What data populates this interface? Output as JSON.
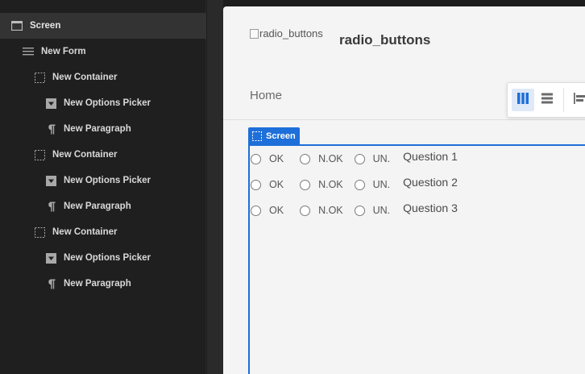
{
  "tree": [
    {
      "label": "Screen",
      "icon": "screen-icon",
      "selected": true
    },
    {
      "label": "New Form",
      "icon": "form-icon"
    },
    {
      "label": "New Container",
      "icon": "container-icon"
    },
    {
      "label": "New Options Picker",
      "icon": "dropdown-icon"
    },
    {
      "label": "New Paragraph",
      "icon": "paragraph-icon"
    },
    {
      "label": "New Container",
      "icon": "container-icon"
    },
    {
      "label": "New Options Picker",
      "icon": "dropdown-icon"
    },
    {
      "label": "New Paragraph",
      "icon": "paragraph-icon"
    },
    {
      "label": "New Container",
      "icon": "container-icon"
    },
    {
      "label": "New Options Picker",
      "icon": "dropdown-icon"
    },
    {
      "label": "New Paragraph",
      "icon": "paragraph-icon"
    }
  ],
  "app": {
    "icon_alt": "radio_buttons",
    "title": "radio_buttons"
  },
  "nav": {
    "home": "Home"
  },
  "toolbar": {
    "buttons": [
      "columns-icon",
      "rows-icon",
      "align-left-icon"
    ],
    "active": "columns-icon"
  },
  "selection": {
    "tag": "Screen"
  },
  "questions": [
    {
      "options": [
        "OK",
        "N.OK",
        "UN."
      ],
      "label": "Question 1"
    },
    {
      "options": [
        "OK",
        "N.OK",
        "UN."
      ],
      "label": "Question 2"
    },
    {
      "options": [
        "OK",
        "N.OK",
        "UN."
      ],
      "label": "Question 3"
    }
  ],
  "colors": {
    "accent": "#1e6fd9",
    "sidebar_bg": "#1f1f1f",
    "canvas_bg": "#f4f4f4"
  }
}
